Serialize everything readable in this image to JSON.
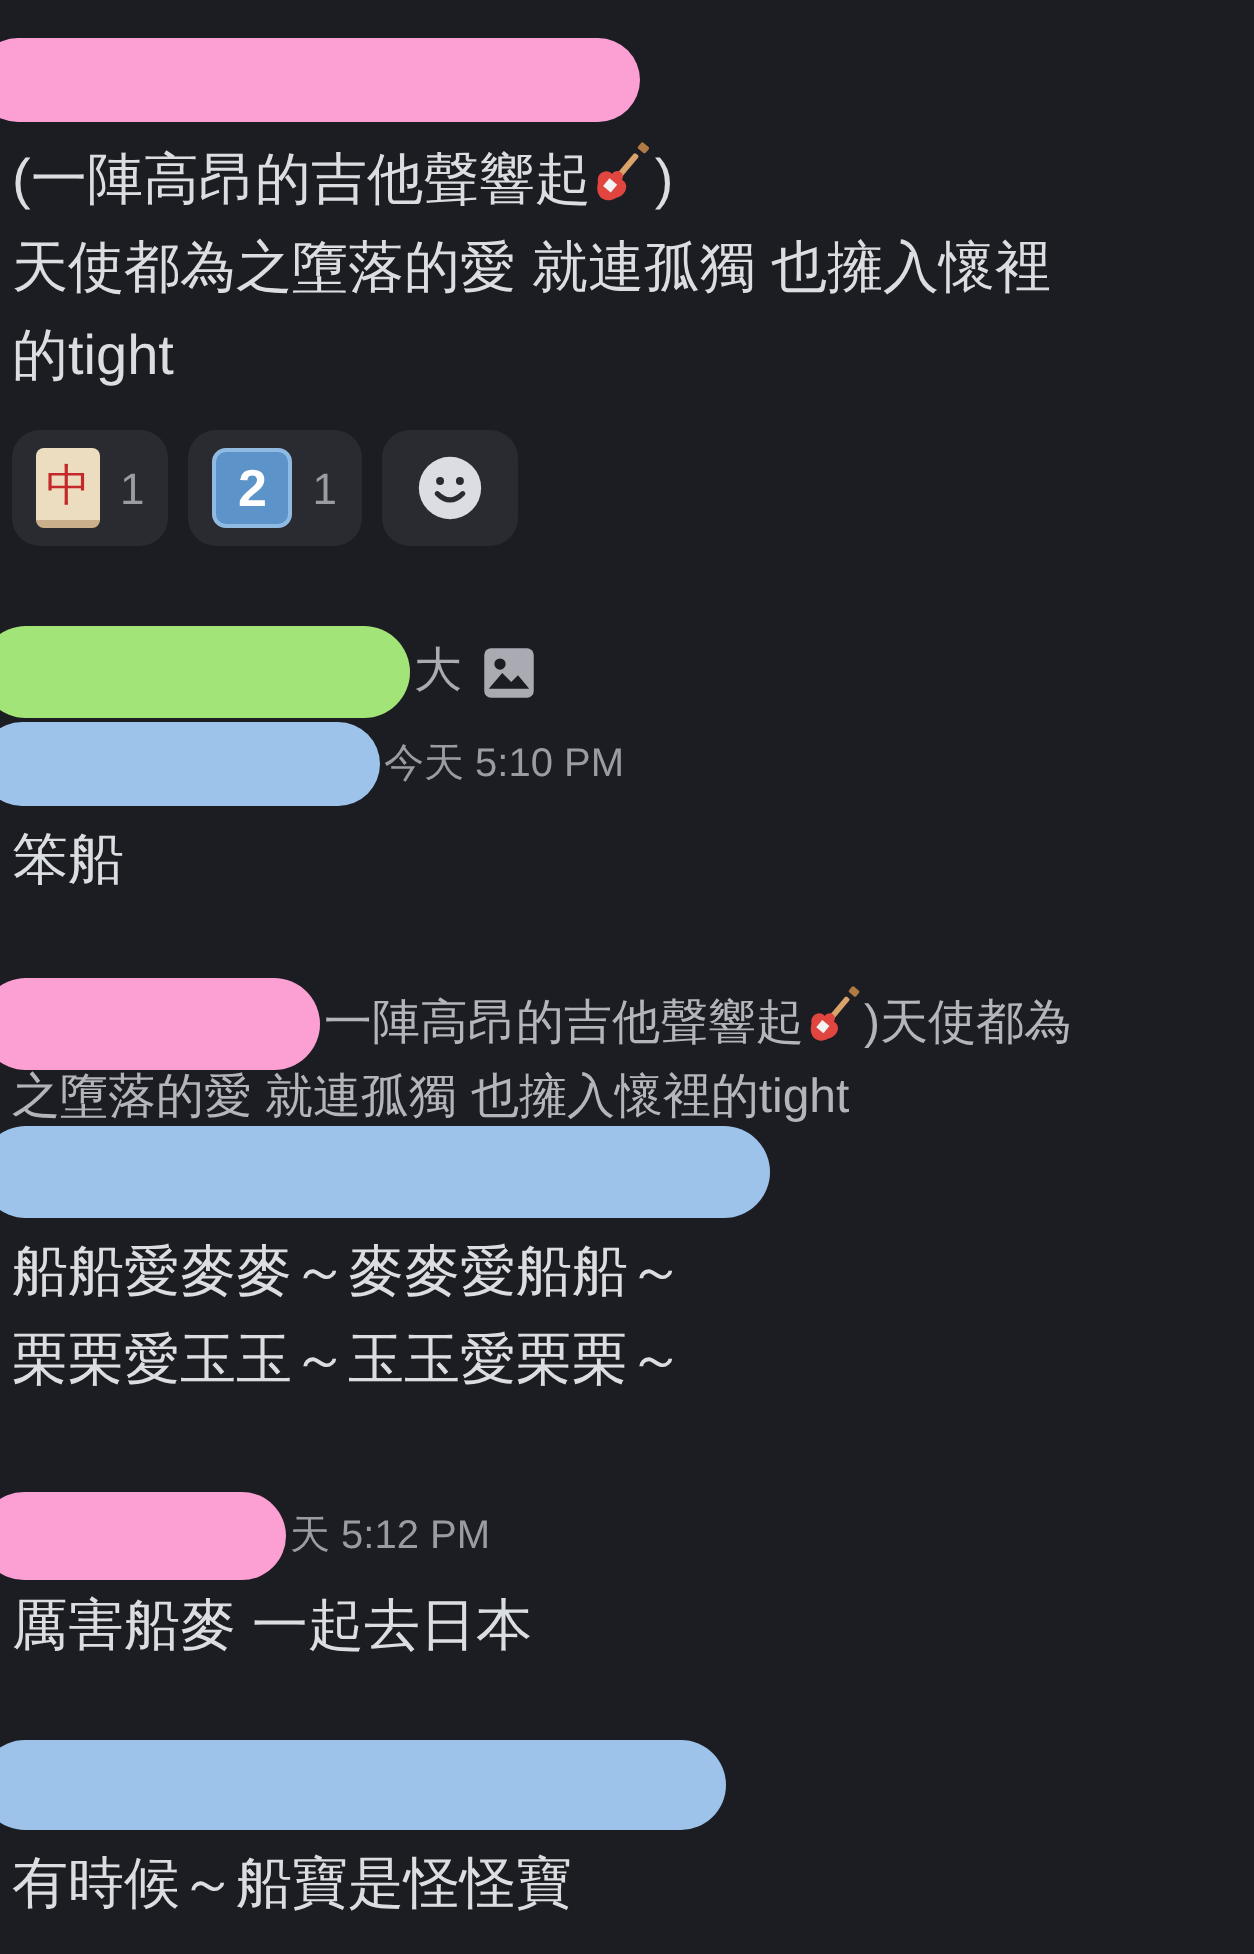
{
  "rows": [
    {
      "kind": "header",
      "redaction": {
        "color": "#fc9fd3"
      }
    },
    {
      "kind": "text",
      "segments": [
        {
          "kind": "text",
          "text": "(一陣高昂的吉他聲響起"
        },
        {
          "kind": "guitar"
        },
        {
          "kind": "text",
          "text": ")"
        }
      ]
    },
    {
      "kind": "text",
      "segments": [
        {
          "kind": "text",
          "text": "天使都為之墮落的愛 就連孤獨 也擁入懷裡"
        }
      ]
    },
    {
      "kind": "text",
      "segments": [
        {
          "kind": "text",
          "text": "的tight"
        }
      ]
    },
    {
      "kind": "reactions",
      "reactions": [
        {
          "kind": "tile",
          "glyph": "中",
          "count": "1"
        },
        {
          "kind": "keycap",
          "glyph": "2",
          "count": "1"
        },
        {
          "kind": "add"
        }
      ]
    },
    {
      "kind": "header",
      "redaction": {
        "color": "#a3e478"
      },
      "tag": "大"
    },
    {
      "kind": "header",
      "redaction": {
        "color": "#9ec3ea"
      },
      "time": "今天 5:10 PM"
    },
    {
      "kind": "text",
      "segments": [
        {
          "kind": "text",
          "text": "笨船"
        }
      ]
    },
    {
      "kind": "reply",
      "redaction": {
        "color": "#fc9fd3"
      },
      "segments": [
        {
          "kind": "text",
          "text": "一陣高昂的吉他聲響起"
        },
        {
          "kind": "guitar"
        },
        {
          "kind": "text",
          "text": ")天使都為"
        }
      ],
      "continuation": "之墮落的愛 就連孤獨 也擁入懷裡的tight"
    },
    {
      "kind": "header",
      "redaction": {
        "color": "#9ec3ea"
      }
    },
    {
      "kind": "text",
      "segments": [
        {
          "kind": "text",
          "text": "船船愛麥麥～麥麥愛船船～"
        }
      ]
    },
    {
      "kind": "text",
      "segments": [
        {
          "kind": "text",
          "text": "栗栗愛玉玉～玉玉愛栗栗～"
        }
      ]
    },
    {
      "kind": "header",
      "redaction": {
        "color": "#fc9fd3"
      },
      "time": "天 5:12 PM"
    },
    {
      "kind": "text",
      "segments": [
        {
          "kind": "text",
          "text": "厲害船麥 一起去日本"
        }
      ]
    },
    {
      "kind": "header",
      "redaction": {
        "color": "#9ec3ea"
      }
    },
    {
      "kind": "text",
      "segments": [
        {
          "kind": "text",
          "text": "有時候～船寶是怪怪寶"
        }
      ]
    }
  ]
}
